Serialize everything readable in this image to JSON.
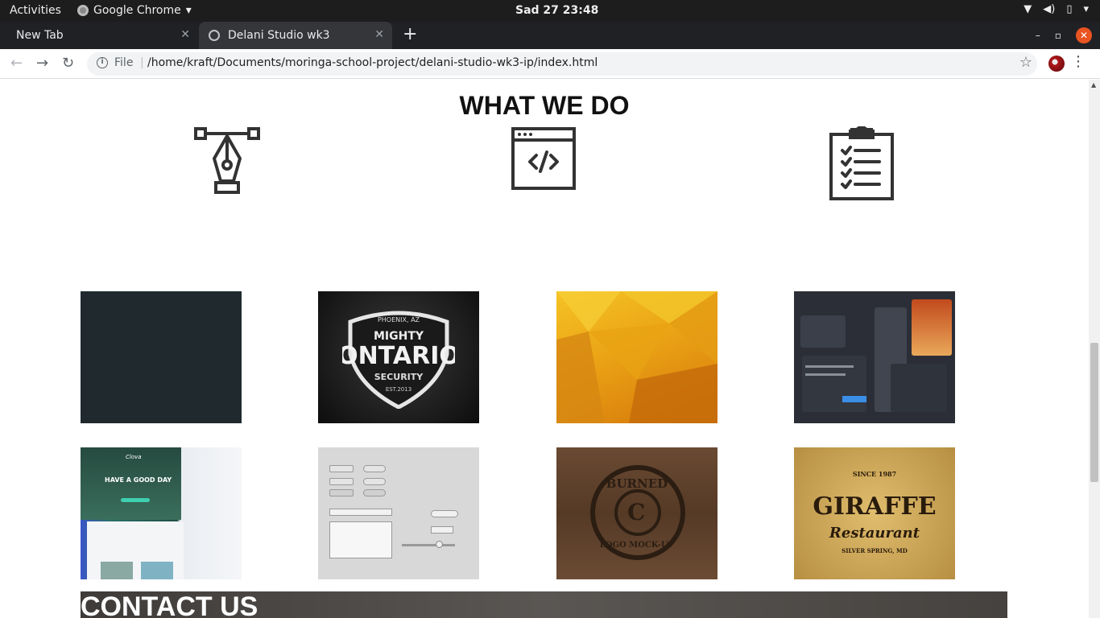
{
  "system_bar": {
    "activities": "Activities",
    "app_name": "Google Chrome",
    "clock": "Sad 27  23:48"
  },
  "browser": {
    "tabs": [
      {
        "label": "New Tab"
      },
      {
        "label": "Delani Studio wk3"
      }
    ],
    "omnibox": {
      "scheme": "File",
      "url": "/home/kraft/Documents/moringa-school-project/delani-studio-wk3-ip/index.html"
    }
  },
  "page": {
    "section_title": "WHAT WE DO",
    "services": [
      {
        "icon": "pen-tool-icon"
      },
      {
        "icon": "code-window-icon"
      },
      {
        "icon": "clipboard-checklist-icon"
      }
    ],
    "portfolio": [
      {
        "name": "dark-tile"
      },
      {
        "name": "mighty-ontario-logo"
      },
      {
        "name": "orange-polygon-art"
      },
      {
        "name": "dashboard-ui-kit"
      },
      {
        "name": "landing-page-template"
      },
      {
        "name": "ui-controls-kit"
      },
      {
        "name": "burned-logo-mockup"
      },
      {
        "name": "giraffe-restaurant-logo"
      }
    ],
    "ontario_text": {
      "top": "PHOENIX, AZ",
      "line1": "MIGHTY",
      "line2": "ONTARIO",
      "line3": "SECURITY",
      "line4": "EST.2013"
    },
    "burned_text": {
      "top": "BURNED",
      "bottom": "LOGO MOCK-UP"
    },
    "giraffe_text": {
      "top": "SINCE 1987",
      "line1": "GIRAFFE",
      "line2": "Restaurant",
      "bottom": "SILVER SPRING, MD"
    },
    "landing_text": {
      "brand": "Clova",
      "headline": "HAVE A GOOD DAY"
    },
    "contact_title": "CONTACT US"
  },
  "colors": {
    "topbar": "#1d1d1d",
    "tabstrip": "#202124",
    "active_tab": "#35363a",
    "close_window": "#e95420"
  }
}
